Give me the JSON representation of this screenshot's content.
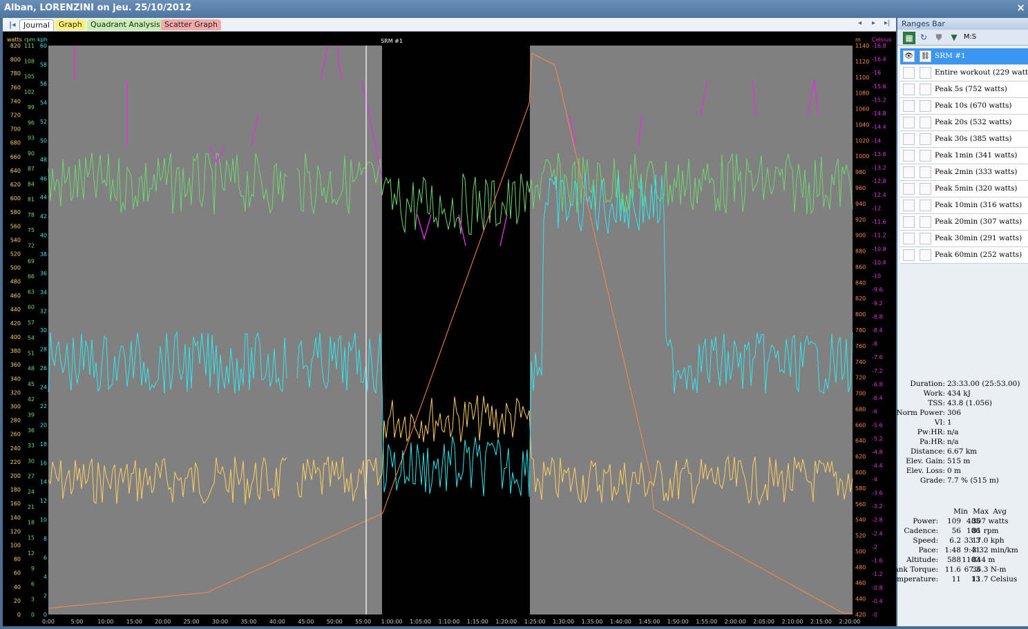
{
  "window": {
    "title": "Alban, LORENZINI on jeu. 25/10/2012",
    "close_glyph": "×"
  },
  "tabs": {
    "first_glyph": "|◂",
    "journal": "Journal",
    "graph": "Graph",
    "quadrant": "Quadrant Analysis",
    "scatter": "Scatter Graph"
  },
  "nav": {
    "prev": "◂",
    "next": "▸",
    "last": "▸|"
  },
  "graph": {
    "title": "SRM #1",
    "left_units": {
      "watts": "watts",
      "rpm": "rpm",
      "kph": "kph"
    },
    "right_units": {
      "m": "m",
      "celsius": "Celsius"
    },
    "watts_ticks": [
      "0",
      "20",
      "40",
      "60",
      "80",
      "100",
      "120",
      "140",
      "160",
      "180",
      "200",
      "220",
      "240",
      "260",
      "280",
      "300",
      "320",
      "340",
      "360",
      "380",
      "400",
      "420",
      "440",
      "460",
      "480",
      "500",
      "520",
      "540",
      "560",
      "580",
      "600",
      "620",
      "640",
      "660",
      "680",
      "700",
      "720",
      "740",
      "760",
      "780",
      "800",
      "820"
    ],
    "rpm_ticks": [
      "0",
      "3",
      "6",
      "9",
      "12",
      "15",
      "18",
      "21",
      "24",
      "27",
      "30",
      "33",
      "36",
      "39",
      "42",
      "45",
      "48",
      "51",
      "54",
      "57",
      "60",
      "63",
      "66",
      "69",
      "72",
      "75",
      "78",
      "81",
      "84",
      "87",
      "90",
      "93",
      "96",
      "99",
      "102",
      "105",
      "108",
      "111"
    ],
    "kph_ticks": [
      "0",
      "2",
      "4",
      "6",
      "8",
      "10",
      "12",
      "14",
      "16",
      "18",
      "20",
      "22",
      "24",
      "26",
      "28",
      "30",
      "32",
      "34",
      "36",
      "38",
      "40",
      "42",
      "44",
      "46",
      "48",
      "50",
      "52",
      "54",
      "56",
      "58",
      "60"
    ],
    "m_ticks": [
      "420",
      "440",
      "460",
      "480",
      "500",
      "520",
      "540",
      "560",
      "580",
      "600",
      "620",
      "640",
      "660",
      "680",
      "700",
      "720",
      "740",
      "760",
      "780",
      "800",
      "820",
      "840",
      "860",
      "880",
      "900",
      "920",
      "940",
      "960",
      "980",
      "1000",
      "1020",
      "1040",
      "1060",
      "1080",
      "1100",
      "1120",
      "1140"
    ],
    "celsius_ticks": [
      "-0",
      "-0.4",
      "-0.8",
      "-1.2",
      "-1.6",
      "-2",
      "-2.4",
      "-2.8",
      "-3.2",
      "-3.6",
      "-4",
      "-4.4",
      "-4.8",
      "-5.2",
      "-5.6",
      "-6",
      "-6.4",
      "-6.8",
      "-7.2",
      "-7.6",
      "-8",
      "-8.4",
      "-8.8",
      "-9.2",
      "-9.6",
      "-10",
      "-10.4",
      "-10.8",
      "-11.2",
      "-11.6",
      "-12",
      "-12.4",
      "-12.8",
      "-13.2",
      "-13.6",
      "-14",
      "-14.4",
      "-14.8",
      "-15.2",
      "-15.6",
      "-16",
      "-16.4",
      "-16.8"
    ],
    "time_ticks": [
      "0:00",
      "5:00",
      "10:00",
      "15:00",
      "20:00",
      "25:00",
      "30:00",
      "35:00",
      "40:00",
      "45:00",
      "50:00",
      "55:00",
      "1:00:00",
      "1:05:00",
      "1:10:00",
      "1:15:00",
      "1:20:00",
      "1:25:00",
      "1:30:00",
      "1:35:00",
      "1:40:00",
      "1:45:00",
      "1:50:00",
      "1:55:00",
      "2:00:00",
      "2:05:00",
      "2:10:00",
      "2:15:00",
      "2:20:00"
    ],
    "selection_start": "58:30",
    "selection_end": "1:24:30",
    "marker": "55:30",
    "colors": {
      "power": "#ffd060",
      "cadence": "#6ed86e",
      "speed": "#30e8f0",
      "altitude": "#ff8a40",
      "temperature": "#e030e0",
      "plot_bg": "#808080",
      "selection_bg": "#000000"
    }
  },
  "ranges_bar": {
    "title": "Ranges Bar",
    "toolbar": {
      "ms_label": "M:S"
    },
    "items": [
      {
        "label": "SRM #1",
        "selected": true
      },
      {
        "label": "Entire workout (229 watts)"
      },
      {
        "label": "Peak 5s (752 watts)"
      },
      {
        "label": "Peak 10s (670 watts)"
      },
      {
        "label": "Peak 20s (532 watts)"
      },
      {
        "label": "Peak 30s (385 watts)"
      },
      {
        "label": "Peak 1min (341 watts)"
      },
      {
        "label": "Peak 2min (333 watts)"
      },
      {
        "label": "Peak 5min (320 watts)"
      },
      {
        "label": "Peak 10min (316 watts)"
      },
      {
        "label": "Peak 20min (307 watts)"
      },
      {
        "label": "Peak 30min (291 watts)"
      },
      {
        "label": "Peak 60min (252 watts)"
      }
    ],
    "summary": [
      {
        "k": "Duration:",
        "v": "23:33.00 (25:53.00)"
      },
      {
        "k": "Work:",
        "v": "434 kJ"
      },
      {
        "k": "TSS:",
        "v": "43.8 (1.056)"
      },
      {
        "k": "Norm Power:",
        "v": "306"
      },
      {
        "k": "VI:",
        "v": "1"
      },
      {
        "k": "Pw:HR:",
        "v": "n/a"
      },
      {
        "k": "Pa:HR:",
        "v": "n/a"
      },
      {
        "k": "Distance:",
        "v": "6.67 km"
      },
      {
        "k": "Elev. Gain:",
        "v": "515 m"
      },
      {
        "k": "Elev. Loss:",
        "v": "0 m"
      },
      {
        "k": "Grade:",
        "v": "7.7 %  (515 m)"
      }
    ],
    "stats_header": {
      "min": "Min",
      "max": "Max",
      "avg": "Avg"
    },
    "stats": [
      {
        "k": "Power:",
        "min": "109",
        "max": "485",
        "avg": "307 watts"
      },
      {
        "k": "Cadence:",
        "min": "56",
        "max": "106",
        "avg": "81 rpm"
      },
      {
        "k": "Speed:",
        "min": "6.2",
        "max": "33.3",
        "avg": "17.0 kph"
      },
      {
        "k": "Pace:",
        "min": "1:48",
        "max": "9:41",
        "avg": "3:32 min/km"
      },
      {
        "k": "Altitude:",
        "min": "588",
        "max": "1103",
        "avg": "844 m"
      },
      {
        "k": "Crank Torque:",
        "min": "11.6",
        "max": "67.3",
        "avg": "36.3 N-m"
      },
      {
        "k": "Temperature:",
        "min": "11",
        "max": "13",
        "avg": "11.7 Celsius"
      }
    ]
  }
}
